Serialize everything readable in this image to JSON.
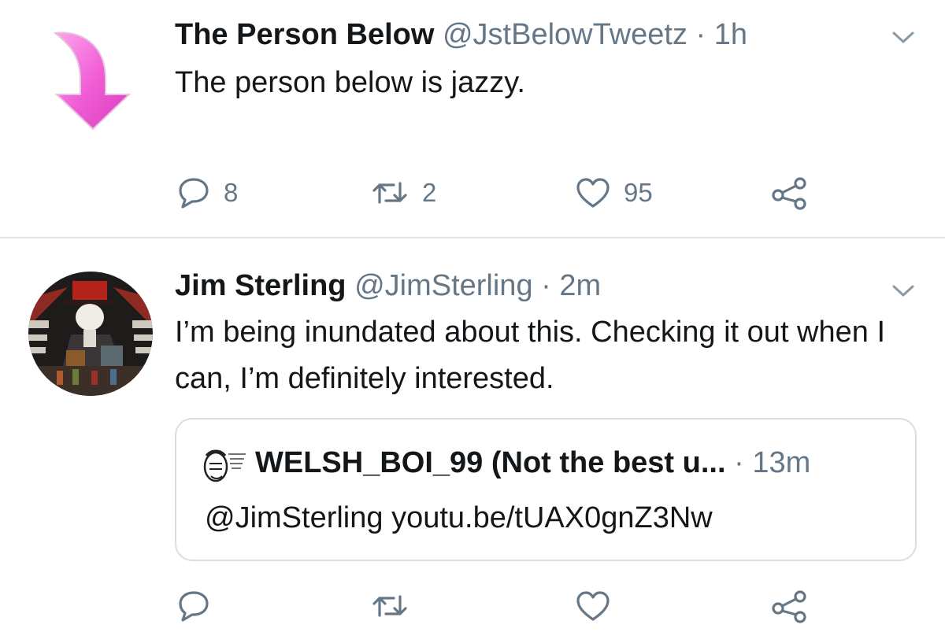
{
  "tweets": [
    {
      "display_name": "The Person Below",
      "handle": "@JstBelowTweetz",
      "separator": "·",
      "time": "1h",
      "text": "The person below is jazzy.",
      "avatar_icon": "pink-down-arrow-icon",
      "counts": {
        "reply": "8",
        "retweet": "2",
        "like": "95"
      }
    },
    {
      "display_name": "Jim Sterling",
      "handle": "@JimSterling",
      "separator": "·",
      "time": "2m",
      "text": "I’m being inundated about this. Checking it out when I can, I’m definitely interested.",
      "avatar_icon": "profile-photo",
      "quoted_tweet": {
        "display_name": "WELSH_BOI_99 (Not the best u...",
        "separator": "·",
        "time": "13m",
        "text": "@JimSterling youtu.be/tUAX0gnZ3Nw",
        "avatar_icon": "sketch-avatar-icon"
      },
      "counts": {
        "reply": "",
        "retweet": "",
        "like": ""
      }
    }
  ],
  "colors": {
    "text": "#14171a",
    "secondary": "#657786",
    "divider": "#dfe4e8",
    "arrow_pink": "#f25ed6"
  }
}
